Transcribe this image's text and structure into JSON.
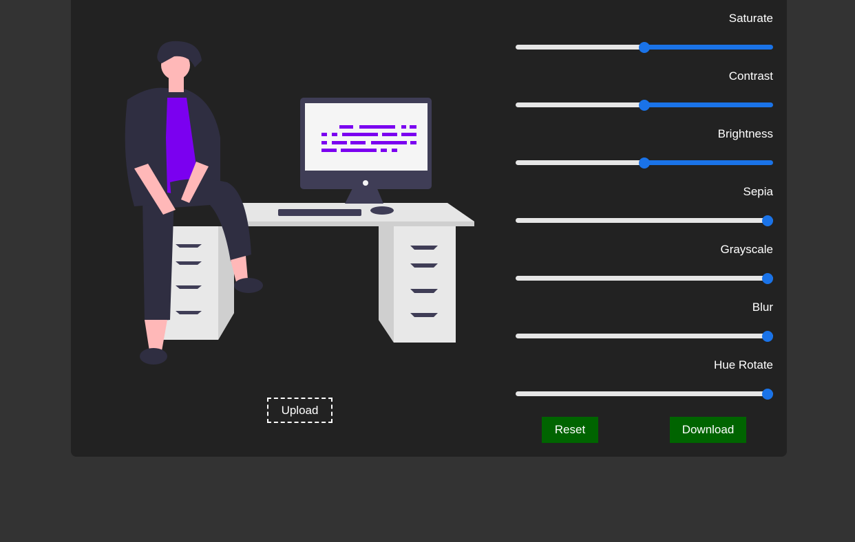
{
  "upload": {
    "label": "Upload"
  },
  "filters": [
    {
      "label": "Saturate",
      "value": 0.5
    },
    {
      "label": "Contrast",
      "value": 0.5
    },
    {
      "label": "Brightness",
      "value": 0.5
    },
    {
      "label": "Sepia",
      "value": 1.0
    },
    {
      "label": "Grayscale",
      "value": 1.0
    },
    {
      "label": "Blur",
      "value": 1.0
    },
    {
      "label": "Hue Rotate",
      "value": 1.0
    }
  ],
  "actions": {
    "reset_label": "Reset",
    "download_label": "Download"
  },
  "colors": {
    "page_background": "#333333",
    "panel_background": "#222222",
    "slider_accent": "#1a73e8",
    "slider_track": "#e6e6e6",
    "action_button": "#006400",
    "illustration_accent": "#7b00f0"
  }
}
